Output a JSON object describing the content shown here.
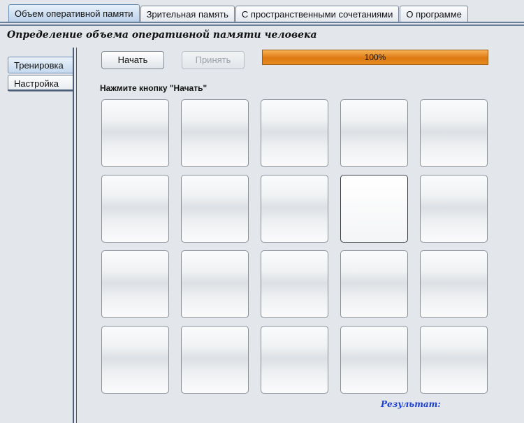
{
  "tabs": [
    {
      "label": "Объем оперативной памяти",
      "active": true
    },
    {
      "label": "Зрительная память",
      "active": false
    },
    {
      "label": "С пространственными сочетаниями",
      "active": false
    },
    {
      "label": "О программе",
      "active": false
    }
  ],
  "page_title": "Определение объема оперативной памяти человека",
  "side_tabs": [
    {
      "label": "Тренировка",
      "active": true
    },
    {
      "label": "Настройка",
      "active": false
    }
  ],
  "buttons": {
    "start": "Начать",
    "accept": "Принять"
  },
  "progress": {
    "text": "100%",
    "value": 1.0
  },
  "instruction": "Нажмите кнопку \"Начать\"",
  "grid": {
    "rows": 4,
    "cols": 5,
    "selected_row": 2,
    "selected_col": 4
  },
  "result_label": "Результат:"
}
